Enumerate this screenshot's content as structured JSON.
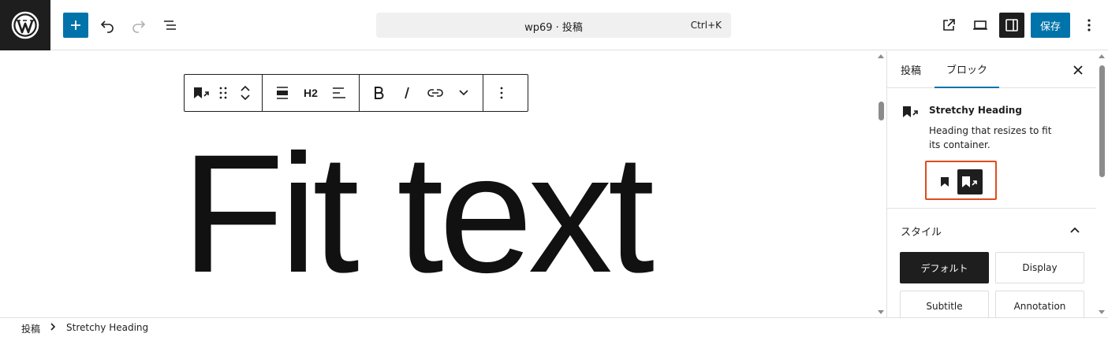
{
  "header": {
    "document_title": "wp69 · 投稿",
    "shortcut": "Ctrl+K",
    "save_label": "保存"
  },
  "toolbar": {
    "heading_level": "H2"
  },
  "canvas": {
    "heading_text": "Fit text"
  },
  "sidebar": {
    "tabs": [
      {
        "label": "投稿"
      },
      {
        "label": "ブロック"
      }
    ],
    "block": {
      "name": "Stretchy Heading",
      "description": "Heading that resizes to fit its container."
    },
    "styles": {
      "title": "スタイル",
      "options": [
        {
          "label": "デフォルト"
        },
        {
          "label": "Display"
        },
        {
          "label": "Subtitle"
        },
        {
          "label": "Annotation"
        }
      ]
    }
  },
  "breadcrumb": {
    "items": [
      {
        "label": "投稿"
      },
      {
        "label": "Stretchy Heading"
      }
    ]
  },
  "colors": {
    "accent": "#0073aa",
    "highlight": "#e04b1d",
    "dark": "#1e1e1e"
  }
}
